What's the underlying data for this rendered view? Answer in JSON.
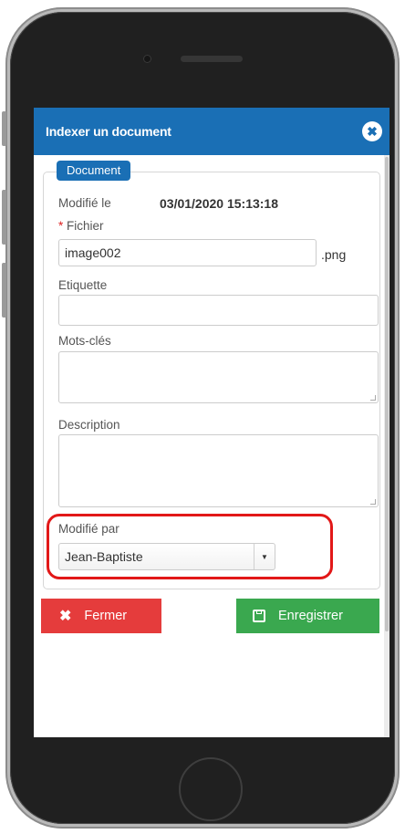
{
  "modal": {
    "title": "Indexer un document",
    "close_glyph": "✖"
  },
  "section": {
    "legend": "Document"
  },
  "form": {
    "modified_label": "Modifié le",
    "modified_value": "03/01/2020 15:13:18",
    "required_mark": "*",
    "file_label": "Fichier",
    "file_value": "image002",
    "file_extension": ".png",
    "label_label": "Etiquette",
    "label_value": "",
    "keywords_label": "Mots-clés",
    "description_label": "Description",
    "modified_by_label": "Modifié par",
    "modified_by_value": "Jean-Baptiste",
    "select_arrow": "▼"
  },
  "buttons": {
    "close_label": "Fermer",
    "close_icon": "✖",
    "save_label": "Enregistrer"
  },
  "colors": {
    "header": "#1a6fb5",
    "close_button": "#e53c3c",
    "save_button": "#3aa84f",
    "highlight": "#e21818"
  }
}
